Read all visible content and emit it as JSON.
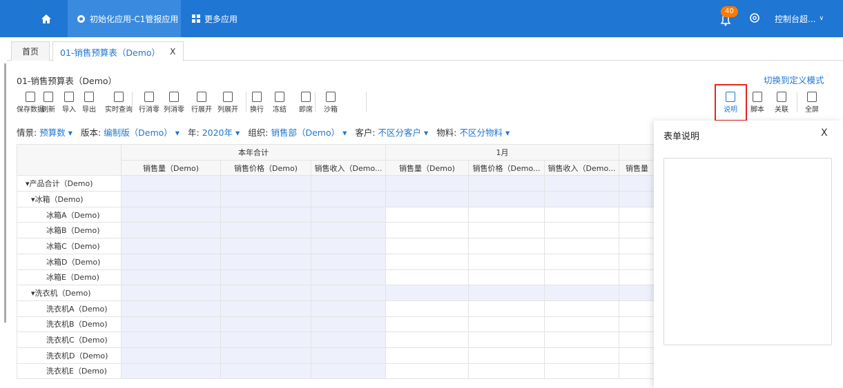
{
  "topbar": {
    "app_tab": "初始化应用-C1管报应用",
    "more_apps": "更多应用",
    "badge_count": "40",
    "user": "控制台超...",
    "accent": "#1f76d3"
  },
  "tabs": {
    "home": "首页",
    "sheet": "01-销售预算表（Demo）",
    "close": "X"
  },
  "page": {
    "title": "01-销售预算表（Demo）",
    "switch_mode": "切换到定义模式"
  },
  "toolbar": {
    "left": [
      {
        "label": "保存数据",
        "icon": "save-icon"
      },
      {
        "label": "刷新",
        "icon": "refresh-icon"
      },
      {
        "label": "导入",
        "icon": "import-icon"
      },
      {
        "label": "导出",
        "icon": "export-icon"
      },
      {
        "label": "实时查询",
        "icon": "realtime-query-icon"
      },
      {
        "label": "行消零",
        "icon": "row-zero-icon"
      },
      {
        "label": "列消零",
        "icon": "col-zero-icon"
      },
      {
        "label": "行展开",
        "icon": "row-expand-icon"
      },
      {
        "label": "列展开",
        "icon": "col-expand-icon"
      },
      {
        "label": "换行",
        "icon": "wrap-icon"
      },
      {
        "label": "冻结",
        "icon": "freeze-icon"
      },
      {
        "label": "即席",
        "icon": "adhoc-icon"
      },
      {
        "label": "沙箱",
        "icon": "sandbox-icon"
      }
    ],
    "right": [
      {
        "label": "说明",
        "icon": "explain-icon"
      },
      {
        "label": "脚本",
        "icon": "script-icon"
      },
      {
        "label": "关联",
        "icon": "link-icon"
      },
      {
        "label": "全屏",
        "icon": "fullscreen-icon"
      }
    ]
  },
  "filters": [
    {
      "label": "情景:",
      "value": "预算数 ▾"
    },
    {
      "label": "版本:",
      "value": "编制版（Demo） ▾"
    },
    {
      "label": "年:",
      "value": "2020年 ▾"
    },
    {
      "label": "组织:",
      "value": "销售部（Demo） ▾"
    },
    {
      "label": "客户:",
      "value": "不区分客户 ▾"
    },
    {
      "label": "物料:",
      "value": "不区分物料 ▾"
    }
  ],
  "table": {
    "group_headers": [
      "本年合计",
      "1月"
    ],
    "col_headers": [
      "销售量（Demo)",
      "销售价格（Demo)",
      "销售收入（Demo...",
      "销售量（Demo)",
      "销售价格（Demo...",
      "销售收入（Demo...",
      "销售量"
    ],
    "rows": [
      "▾产品合计（Demo)",
      "▾冰箱（Demo)",
      "冰箱A（Demo)",
      "冰箱B（Demo)",
      "冰箱C（Demo)",
      "冰箱D（Demo)",
      "冰箱E（Demo)",
      "▾洗衣机（Demo)",
      "洗衣机A（Demo)",
      "洗衣机B（Demo)",
      "洗衣机C（Demo)",
      "洗衣机D（Demo)",
      "洗衣机E（Demo)"
    ]
  },
  "panel": {
    "title": "表单说明",
    "close": "X"
  }
}
